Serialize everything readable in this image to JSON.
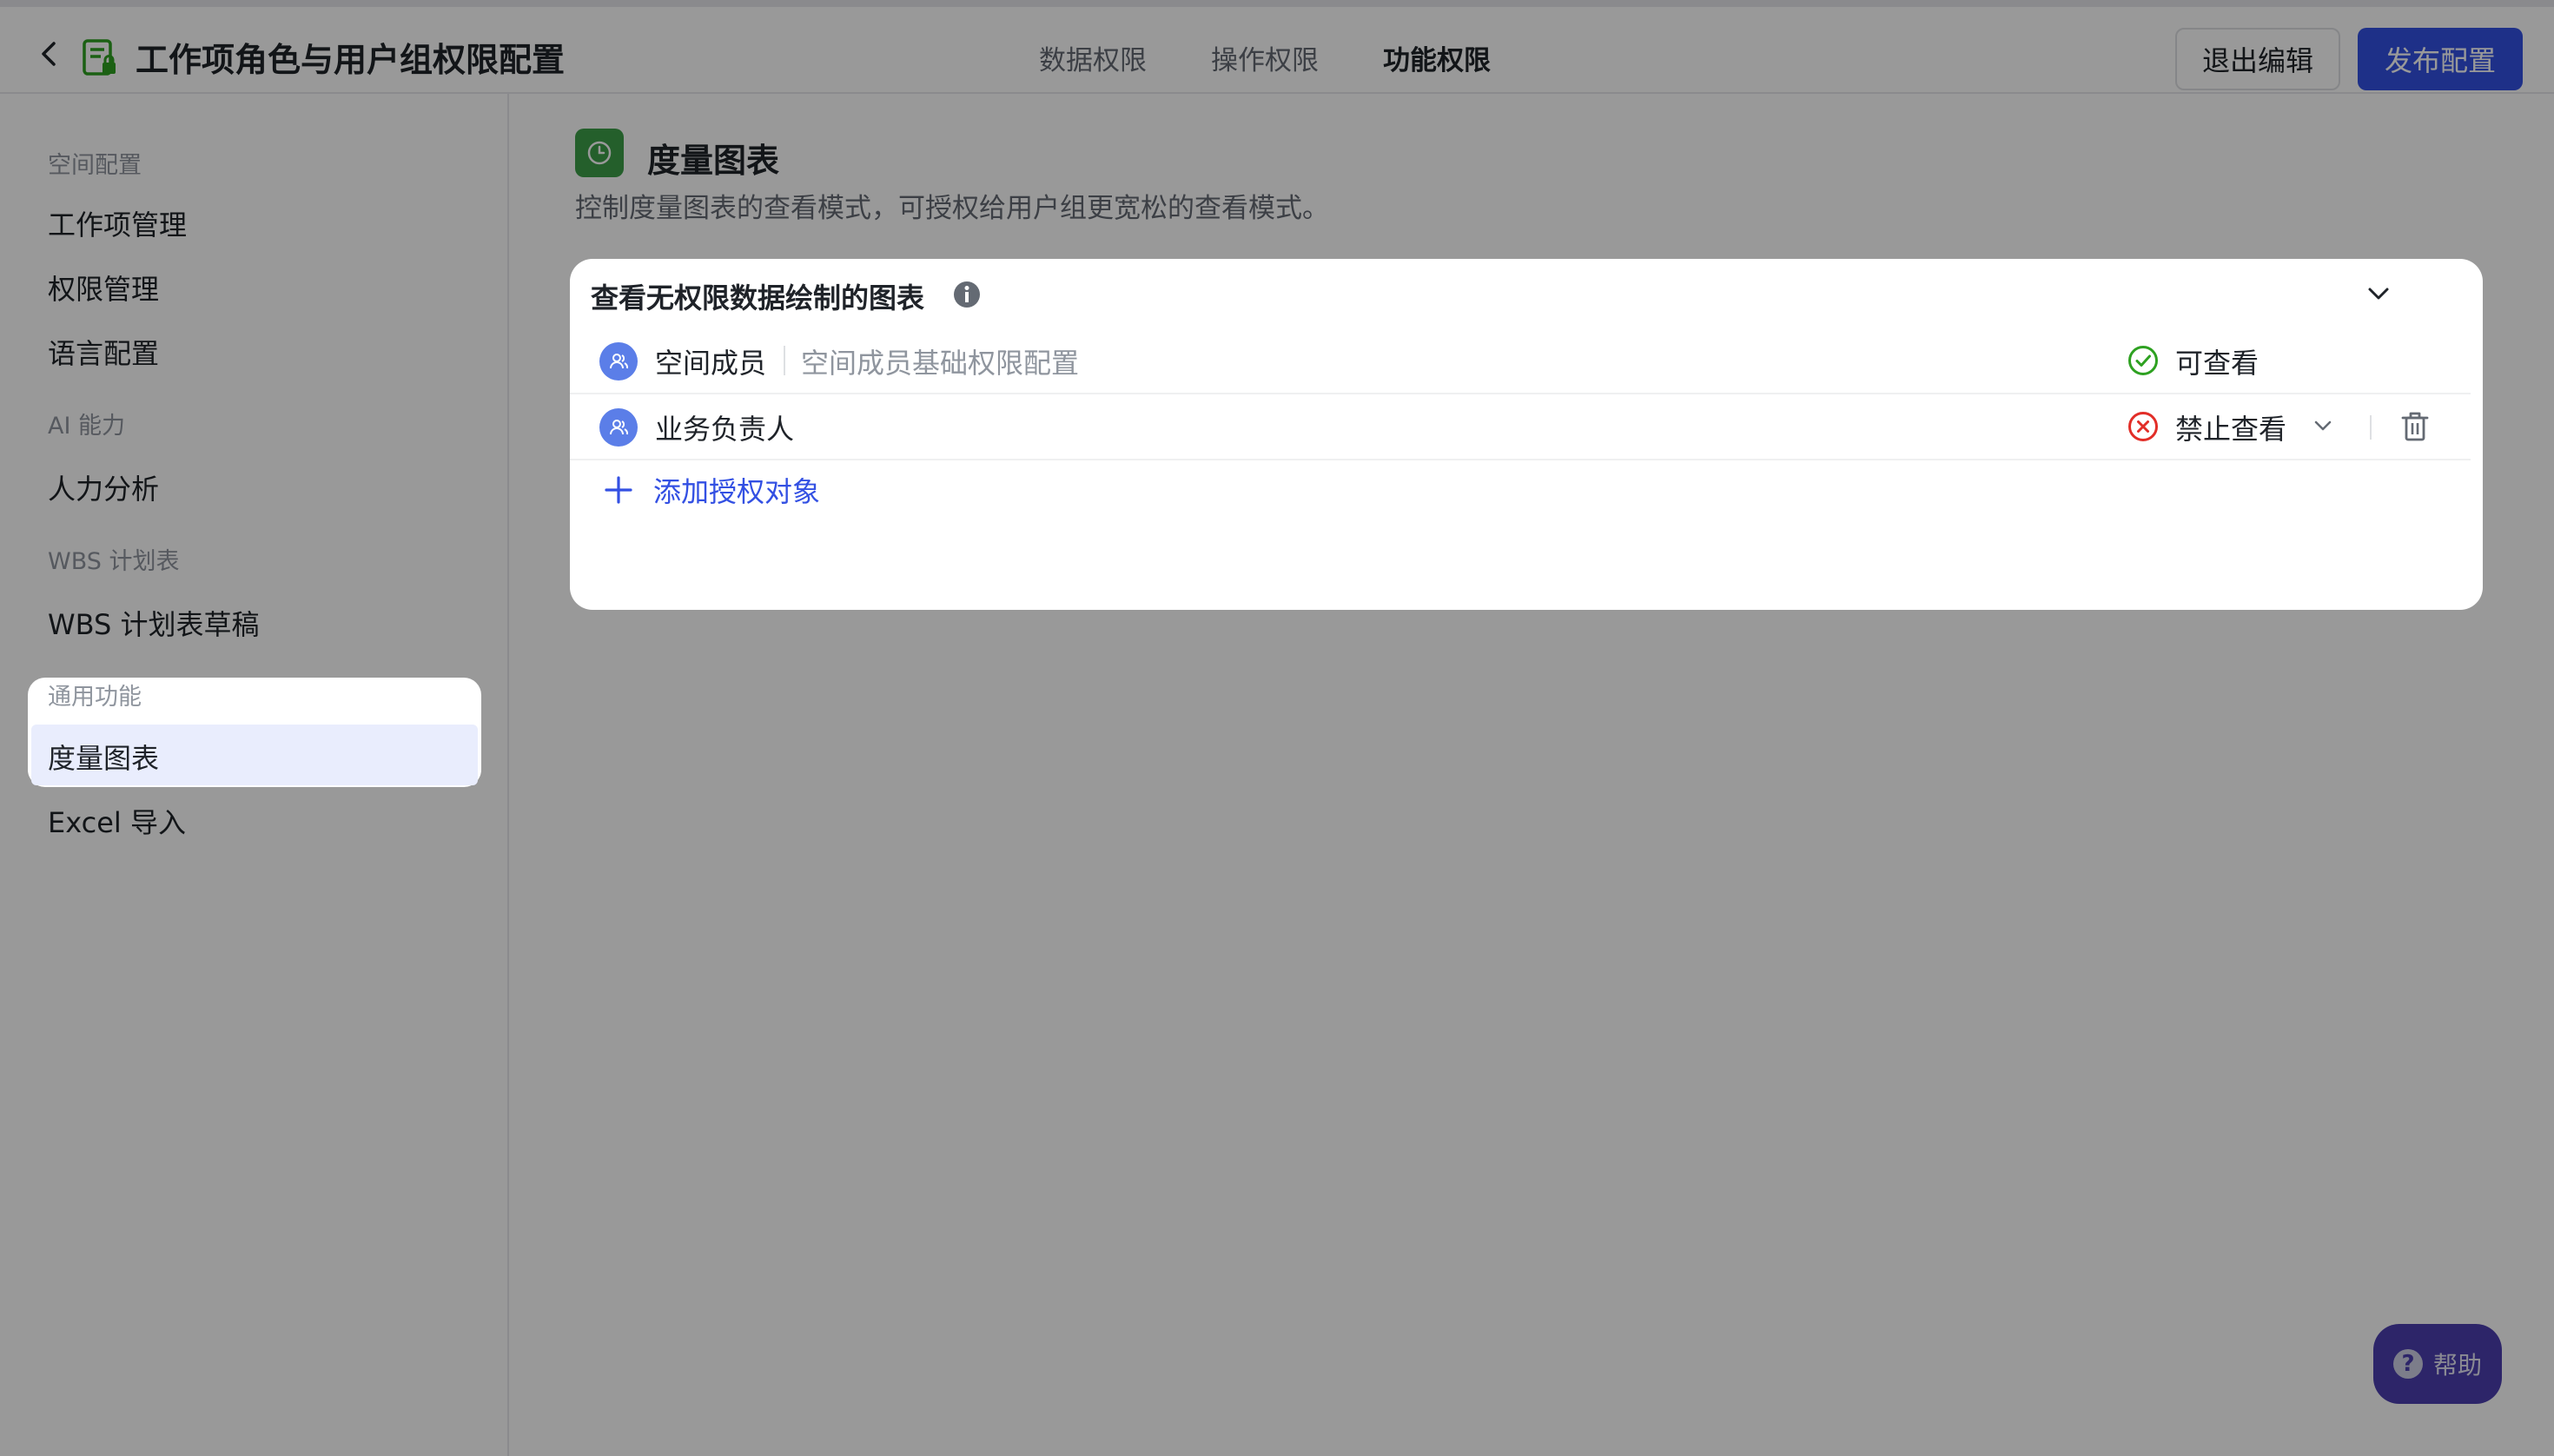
{
  "header": {
    "title": "工作项角色与用户组权限配置",
    "tabs": [
      {
        "label": "数据权限",
        "active": false
      },
      {
        "label": "操作权限",
        "active": false
      },
      {
        "label": "功能权限",
        "active": true
      }
    ],
    "exit_label": "退出编辑",
    "publish_label": "发布配置"
  },
  "sidebar": {
    "group_space": "空间配置",
    "item_workitem": "工作项管理",
    "item_permission": "权限管理",
    "item_language": "语言配置",
    "group_ai": "AI 能力",
    "item_hr": "人力分析",
    "group_wbs": "WBS 计划表",
    "item_wbs_draft": "WBS 计划表草稿",
    "group_common": "通用功能",
    "item_metric_chart": "度量图表",
    "item_excel_import": "Excel 导入"
  },
  "main": {
    "section_title": "度量图表",
    "section_desc": "控制度量图表的查看模式，可授权给用户组更宽松的查看模式。",
    "card": {
      "title": "查看无权限数据绘制的图表",
      "rows": [
        {
          "name": "空间成员",
          "desc": "空间成员基础权限配置",
          "status": "可查看"
        },
        {
          "name": "业务负责人",
          "status": "禁止查看"
        }
      ],
      "add_label": "添加授权对象"
    }
  },
  "help": {
    "label": "帮助"
  },
  "colors": {
    "accent": "#3350e3",
    "success": "#2ea121",
    "danger": "#e22e28",
    "section_icon_bg": "#3c9f49"
  }
}
